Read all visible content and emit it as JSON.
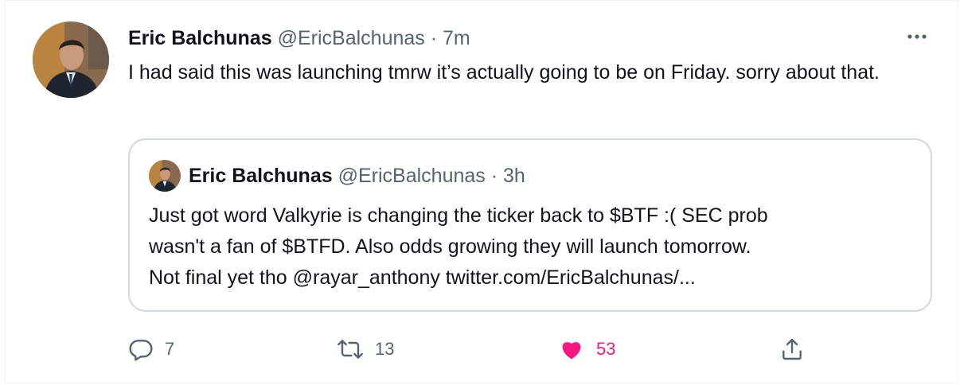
{
  "tweet": {
    "author_name": "Eric Balchunas",
    "handle": "@EricBalchunas",
    "separator": "·",
    "time": "7m",
    "text": "I had said this was launching tmrw it’s actually going to be on Friday. sorry about that.",
    "more_icon": "more-horizontal-icon"
  },
  "quoted": {
    "author_name": "Eric Balchunas",
    "handle": "@EricBalchunas",
    "separator": "·",
    "time": "3h",
    "text_line1": "Just got word Valkyrie is changing the ticker back to $BTF :(   SEC prob",
    "text_line2": "wasn't a fan of $BTFD. Also odds growing they will launch tomorrow.",
    "text_line3": "Not final yet tho  @rayar_anthony twitter.com/EricBalchunas/..."
  },
  "actions": {
    "reply": {
      "icon": "reply-icon",
      "count": "7"
    },
    "retweet": {
      "icon": "retweet-icon",
      "count": "13"
    },
    "like": {
      "icon": "heart-icon",
      "count": "53",
      "liked": true,
      "color": "#f91880"
    },
    "share": {
      "icon": "share-icon"
    }
  },
  "colors": {
    "secondary_text": "#536471",
    "border": "#cfd9de",
    "like": "#f91880"
  }
}
